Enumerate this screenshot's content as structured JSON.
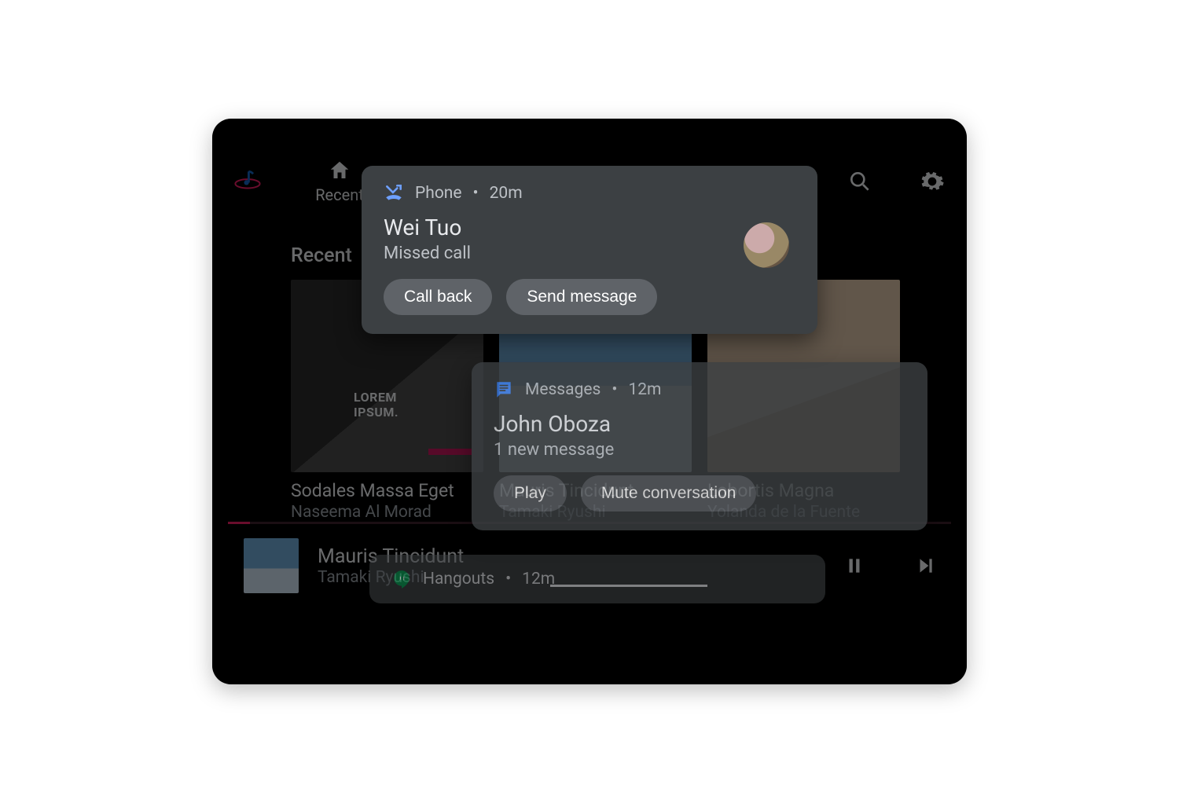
{
  "nav": {
    "tab_recent": "Recent"
  },
  "section": {
    "recent": "Recent"
  },
  "albums": [
    {
      "title": "Sodales Massa Eget",
      "artist": "Naseema Al Morad"
    },
    {
      "title": "Mauris Tincidunt",
      "artist": "Tamaki Ryushi"
    },
    {
      "title": "Lobortis Magna",
      "artist": "Yolanda de la Fuente"
    }
  ],
  "nowplaying": {
    "title": "Mauris Tincidunt",
    "artist": "Tamaki Ryushi"
  },
  "notifications": {
    "phone": {
      "app": "Phone",
      "time": "20m",
      "title": "Wei Tuo",
      "subtitle": "Missed call",
      "action_callback": "Call back",
      "action_message": "Send message"
    },
    "messages": {
      "app": "Messages",
      "time": "12m",
      "title": "John Oboza",
      "subtitle": "1 new message",
      "action_play": "Play",
      "action_mute": "Mute conversation"
    },
    "hangouts": {
      "app": "Hangouts",
      "time": "12m"
    }
  }
}
